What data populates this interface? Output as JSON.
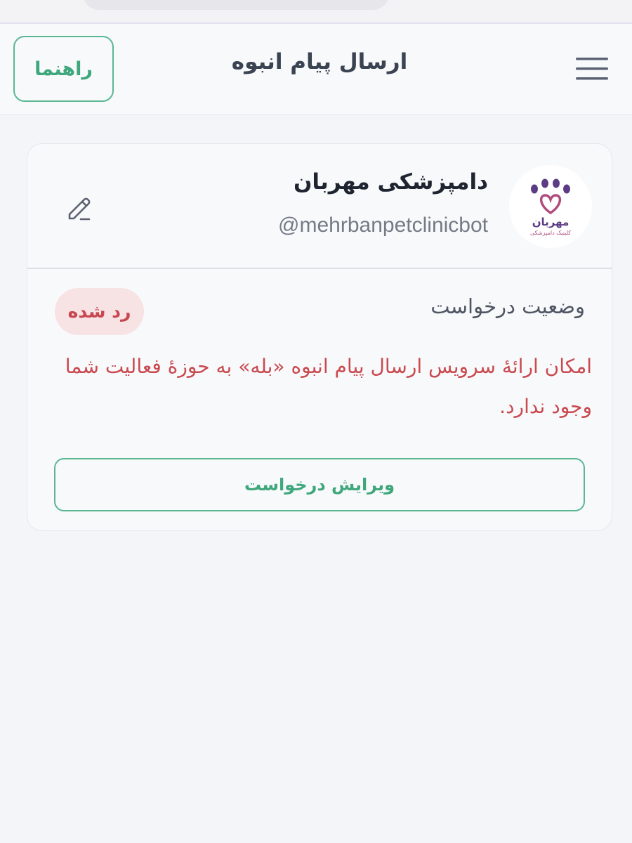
{
  "header": {
    "title": "ارسال پیام انبوه",
    "help_label": "راهنما",
    "menu_icon": "hamburger-menu-icon"
  },
  "bot": {
    "name": "دامپزشکی مهربان",
    "username": "@mehrbanpetclinicbot",
    "avatar": {
      "logo_text": "مهربان",
      "logo_subtext": "کلینیک دامپزشکی"
    },
    "edit_icon": "pencil-icon"
  },
  "request": {
    "status_label": "وضعیت درخواست",
    "status_value": "رد شده",
    "message": "امکان ارائهٔ سرویس ارسال پیام انبوه «بله» به حوزهٔ فعالیت شما وجود ندارد.",
    "edit_button_label": "ویرایش درخواست"
  },
  "colors": {
    "accent_green": "#3fa77c",
    "error_red": "#c94a4f",
    "badge_bg": "#f7e2e4",
    "logo_purple": "#5c3c84",
    "logo_heart": "#b04c7c"
  }
}
